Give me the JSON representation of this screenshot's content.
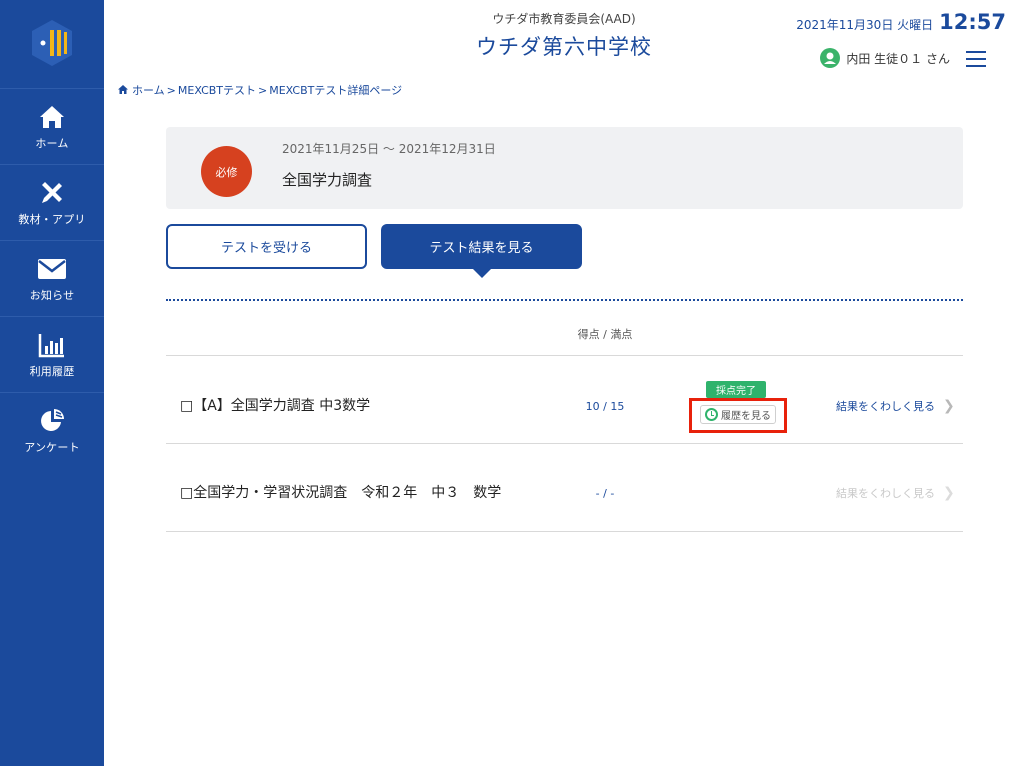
{
  "sidebar": {
    "items": [
      {
        "label": "ホーム",
        "icon": "home-icon"
      },
      {
        "label": "教材・アプリ",
        "icon": "tools-icon"
      },
      {
        "label": "お知らせ",
        "icon": "mail-icon"
      },
      {
        "label": "利用履歴",
        "icon": "bar-chart-icon"
      },
      {
        "label": "アンケート",
        "icon": "pie-chart-icon"
      }
    ]
  },
  "header": {
    "board_name": "ウチダ市教育委員会(AAD)",
    "school_name": "ウチダ第六中学校",
    "date": "2021年11月30日 火曜日",
    "time": "12:57",
    "user_name": "内田 生徒０１ さん"
  },
  "breadcrumb": {
    "items": [
      "ホーム",
      "MEXCBTテスト",
      "MEXCBTテスト詳細ページ"
    ],
    "separator": ">"
  },
  "info": {
    "badge": "必修",
    "period": "2021年11月25日 〜 2021年12月31日",
    "title": "全国学力調査"
  },
  "tabs": {
    "take_test": "テストを受ける",
    "view_results": "テスト結果を見る"
  },
  "table": {
    "score_header": "得点 / 満点",
    "rows": [
      {
        "name": "□【A】全国学力調査 中3数学",
        "score": "10 / 15",
        "status": "採点完了",
        "history": "履歴を見る",
        "link": "結果をくわしく見る"
      },
      {
        "name": "□全国学力・学習状況調査　令和２年　中３　数学",
        "score": "- / -",
        "link": "結果をくわしく見る"
      }
    ]
  },
  "colors": {
    "primary": "#1b4a9c",
    "required": "#d6411f",
    "success": "#2fb36c",
    "highlight": "#e8210b"
  }
}
